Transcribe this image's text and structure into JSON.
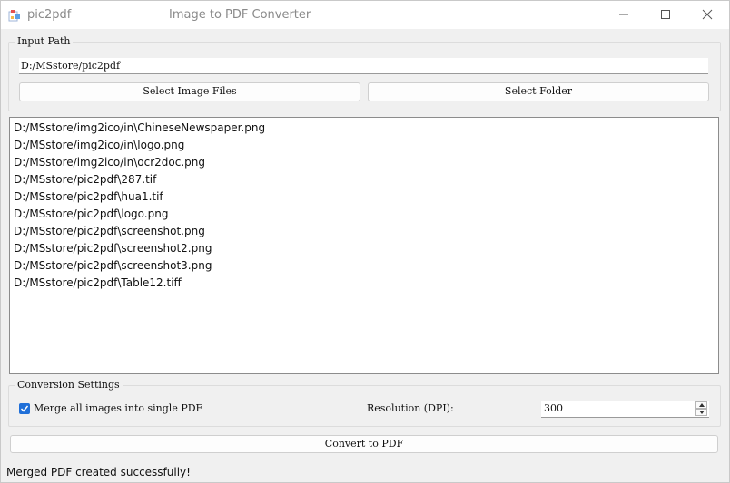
{
  "window": {
    "app_name": "pic2pdf",
    "title": "Image to PDF Converter"
  },
  "input": {
    "group_title": "Input Path",
    "path_value": "D:/MSstore/pic2pdf",
    "select_files_label": "Select Image Files",
    "select_folder_label": "Select Folder"
  },
  "files": [
    "D:/MSstore/img2ico/in\\ChineseNewspaper.png",
    "D:/MSstore/img2ico/in\\logo.png",
    "D:/MSstore/img2ico/in\\ocr2doc.png",
    "D:/MSstore/pic2pdf\\287.tif",
    "D:/MSstore/pic2pdf\\hua1.tif",
    "D:/MSstore/pic2pdf\\logo.png",
    "D:/MSstore/pic2pdf\\screenshot.png",
    "D:/MSstore/pic2pdf\\screenshot2.png",
    "D:/MSstore/pic2pdf\\screenshot3.png",
    "D:/MSstore/pic2pdf\\Table12.tiff"
  ],
  "conversion": {
    "group_title": "Conversion Settings",
    "merge_label": "Merge all images into single PDF",
    "merge_checked": true,
    "resolution_label": "Resolution (DPI):",
    "resolution_value": "300"
  },
  "convert_label": "Convert to PDF",
  "status": "Merged PDF created successfully!",
  "colors": {
    "accent": "#1f6fd8"
  },
  "icons": [
    "app-icon",
    "minimize-icon",
    "maximize-icon",
    "close-icon",
    "checkmark-icon",
    "spin-up-icon",
    "spin-down-icon"
  ]
}
